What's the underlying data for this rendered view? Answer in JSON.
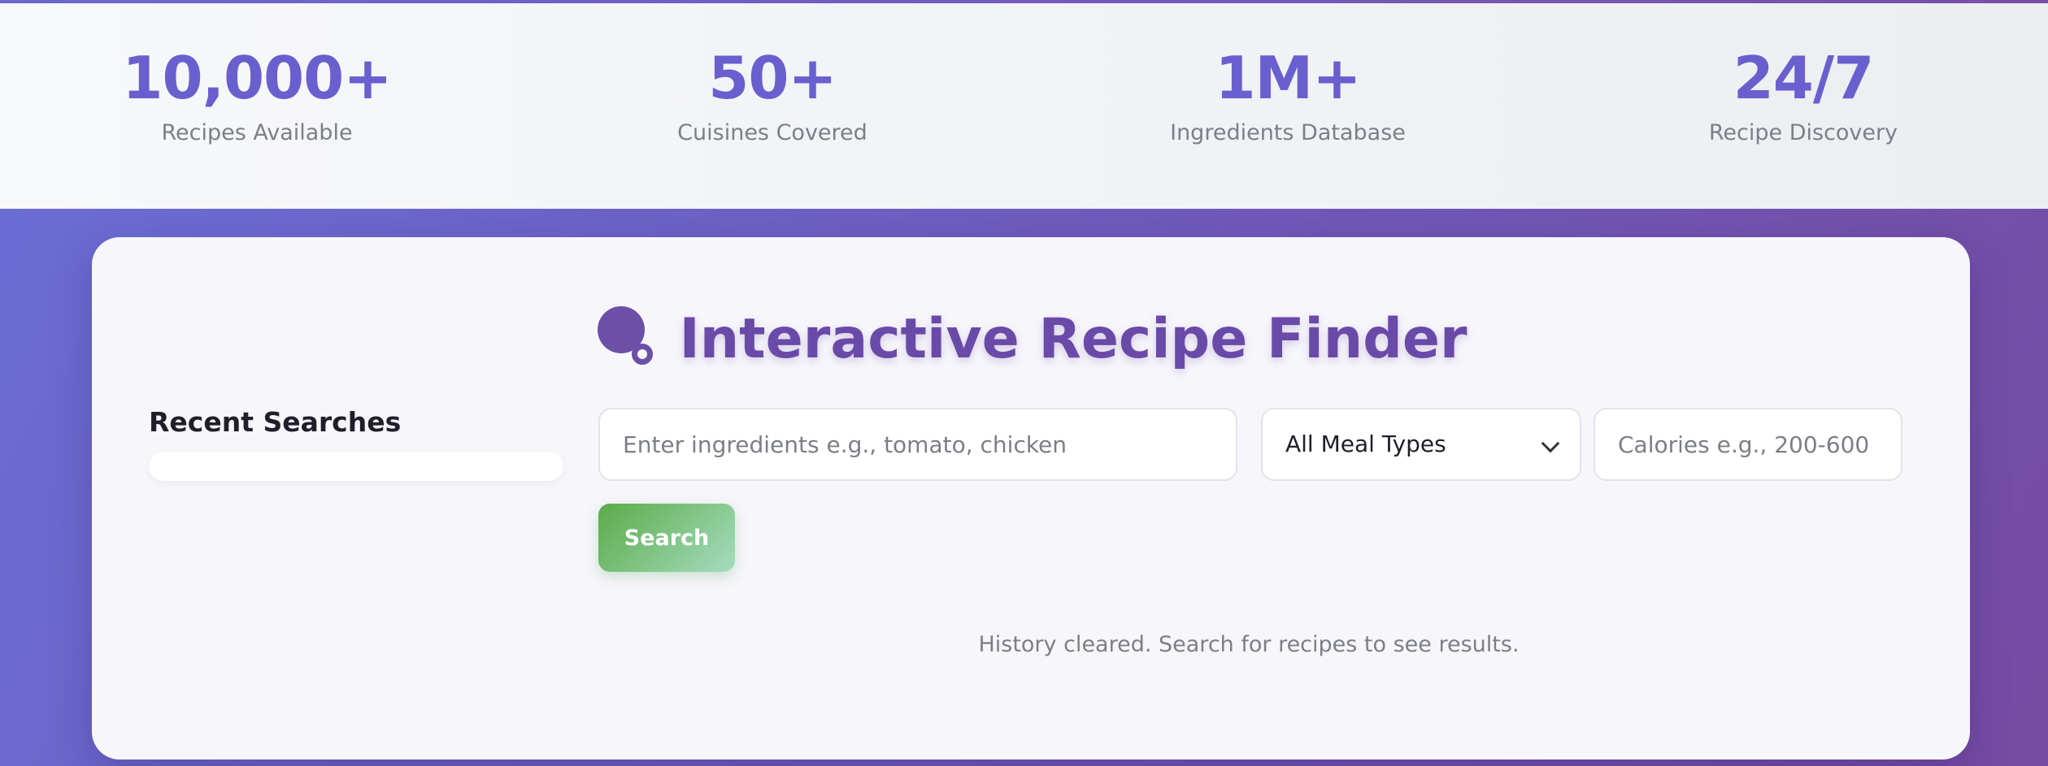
{
  "stats": [
    {
      "value": "10,000+",
      "label": "Recipes Available"
    },
    {
      "value": "50+",
      "label": "Cuisines Covered"
    },
    {
      "value": "1M+",
      "label": "Ingredients Database"
    },
    {
      "value": "24/7",
      "label": "Recipe Discovery"
    }
  ],
  "finder": {
    "title": "Interactive Recipe Finder",
    "title_icon": "magnifier-icon",
    "recent_heading": "Recent Searches",
    "ingredients_placeholder": "Enter ingredients e.g., tomato, chicken",
    "meal_type_selected": "All Meal Types",
    "calories_placeholder": "Calories e.g., 200-600",
    "search_label": "Search",
    "status_text": "History cleared. Search for recipes to see results."
  },
  "colors": {
    "accent": "#6a5fcf",
    "title": "#6a4aa8",
    "button_start": "#5bab48",
    "button_end": "#a5dcc0"
  }
}
